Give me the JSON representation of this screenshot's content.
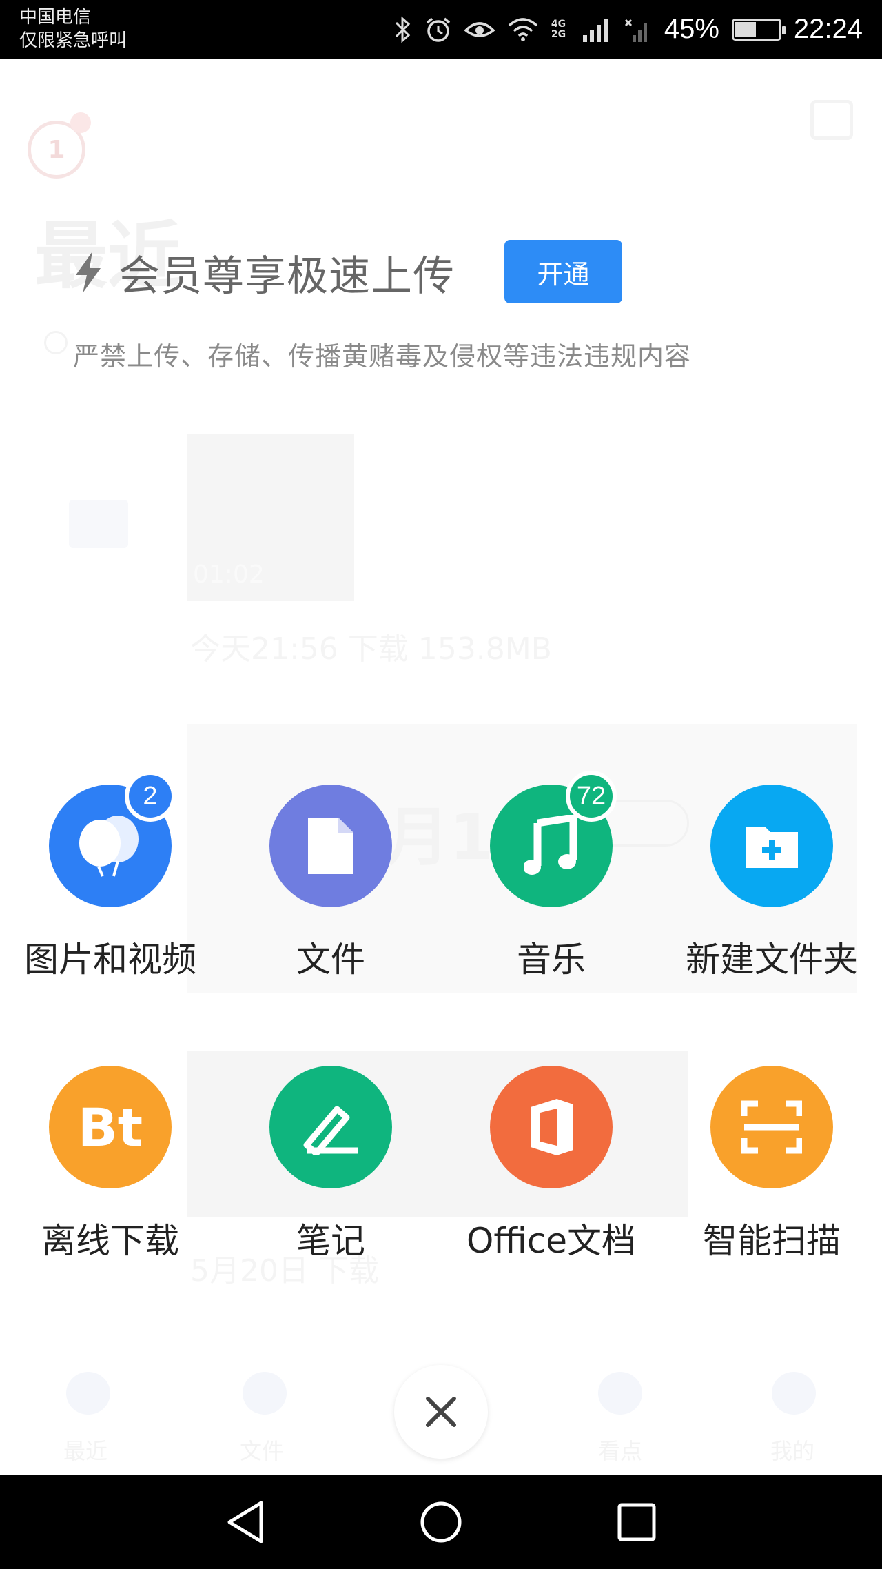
{
  "status_bar": {
    "carrier_line1": "中国电信",
    "carrier_line2": "仅限紧急呼叫",
    "network": "4G 2G",
    "battery": "45%",
    "battery_level": 0.45,
    "time": "22:24"
  },
  "upload_panel": {
    "promo_text": "会员尊享极速上传",
    "open_button": "开通",
    "warning": "严禁上传、存储、传播黄赌毒及侵权等违法违规内容",
    "items": [
      {
        "label": "图片和视频",
        "icon": "balloons-icon",
        "color": "#2d7ff5",
        "badge": "2"
      },
      {
        "label": "文件",
        "icon": "file-icon",
        "color": "#6f7de0",
        "badge": ""
      },
      {
        "label": "音乐",
        "icon": "music-note-icon",
        "color": "#0fb57e",
        "badge": "72"
      },
      {
        "label": "新建文件夹",
        "icon": "new-folder-icon",
        "color": "#08a8f2",
        "badge": ""
      },
      {
        "label": "离线下载",
        "icon": "bt-icon",
        "color": "#f9a12b",
        "badge": ""
      },
      {
        "label": "笔记",
        "icon": "pen-icon",
        "color": "#0fb57e",
        "badge": ""
      },
      {
        "label": "Office文档",
        "icon": "office-icon",
        "color": "#f26c3e",
        "badge": ""
      },
      {
        "label": "智能扫描",
        "icon": "scan-icon",
        "color": "#f9a12b",
        "badge": ""
      }
    ]
  },
  "background": {
    "title": "最近",
    "duration": "01:02",
    "upload_info": "今天21:56 下载 153.8MB",
    "card_date": "月1",
    "bottom_info": "5月20日 下载",
    "tabs": [
      "最近",
      "文件",
      "",
      "看点",
      "我的"
    ]
  },
  "navbar": {
    "back": "back-icon",
    "home": "home-icon",
    "recents": "recents-icon"
  }
}
